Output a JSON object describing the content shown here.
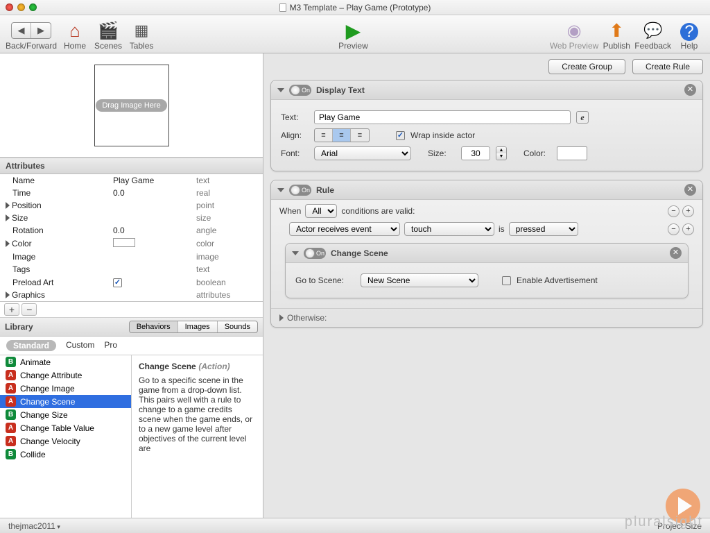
{
  "window": {
    "title": "M3 Template – Play Game (Prototype)"
  },
  "toolbar": {
    "back_fwd": "Back/Forward",
    "home": "Home",
    "scenes": "Scenes",
    "tables": "Tables",
    "preview": "Preview",
    "web_preview": "Web Preview",
    "publish": "Publish",
    "feedback": "Feedback",
    "help": "Help"
  },
  "actor_preview": {
    "placeholder": "Drag Image Here"
  },
  "sections": {
    "attributes": "Attributes",
    "library": "Library"
  },
  "attrs": [
    {
      "name": "Name",
      "value": "Play Game",
      "type": "text",
      "disclose": false
    },
    {
      "name": "Time",
      "value": "0.0",
      "type": "real",
      "disclose": false
    },
    {
      "name": "Position",
      "value": "",
      "type": "point",
      "disclose": true
    },
    {
      "name": "Size",
      "value": "",
      "type": "size",
      "disclose": true
    },
    {
      "name": "Rotation",
      "value": "0.0",
      "type": "angle",
      "disclose": false
    },
    {
      "name": "Color",
      "value": "__swatch",
      "type": "color",
      "disclose": true
    },
    {
      "name": "Image",
      "value": "",
      "type": "image",
      "disclose": false
    },
    {
      "name": "Tags",
      "value": "",
      "type": "text",
      "disclose": false
    },
    {
      "name": "Preload Art",
      "value": "__checked",
      "type": "boolean",
      "disclose": false
    },
    {
      "name": "Graphics",
      "value": "",
      "type": "attributes",
      "disclose": true
    }
  ],
  "library": {
    "tabs": [
      "Behaviors",
      "Images",
      "Sounds"
    ],
    "active_tab": "Behaviors",
    "filters": [
      "Standard",
      "Custom",
      "Pro"
    ],
    "active_filter": "Standard",
    "items": [
      {
        "tag": "B",
        "name": "Animate"
      },
      {
        "tag": "A",
        "name": "Change Attribute"
      },
      {
        "tag": "A",
        "name": "Change Image"
      },
      {
        "tag": "A",
        "name": "Change Scene",
        "selected": true
      },
      {
        "tag": "B",
        "name": "Change Size"
      },
      {
        "tag": "A",
        "name": "Change Table Value"
      },
      {
        "tag": "A",
        "name": "Change Velocity"
      },
      {
        "tag": "B",
        "name": "Collide"
      }
    ],
    "desc_title": "Change Scene",
    "desc_kind": "(Action)",
    "desc_body": "Go to a specific scene in the game from a drop-down list. This pairs well with a rule to change to a game credits scene when the game ends, or to a new game level after objectives of the current level are"
  },
  "right": {
    "create_group": "Create Group",
    "create_rule": "Create Rule",
    "display_text": {
      "title": "Display Text",
      "text_label": "Text:",
      "text_value": "Play Game",
      "align_label": "Align:",
      "wrap_label": "Wrap inside actor",
      "wrap_checked": true,
      "font_label": "Font:",
      "font_value": "Arial",
      "size_label": "Size:",
      "size_value": "30",
      "color_label": "Color:"
    },
    "rule": {
      "title": "Rule",
      "when": "When",
      "quantifier": "All",
      "tail": "conditions are valid:",
      "cond_subject": "Actor receives event",
      "cond_event": "touch",
      "cond_is": "is",
      "cond_state": "pressed",
      "change_scene": {
        "title": "Change Scene",
        "goto_label": "Go to Scene:",
        "goto_value": "New Scene",
        "ad_label": "Enable Advertisement",
        "ad_checked": false
      },
      "otherwise": "Otherwise:"
    }
  },
  "status": {
    "user": "thejmac2011",
    "right": "Project Size"
  },
  "brand": "pluralsight"
}
